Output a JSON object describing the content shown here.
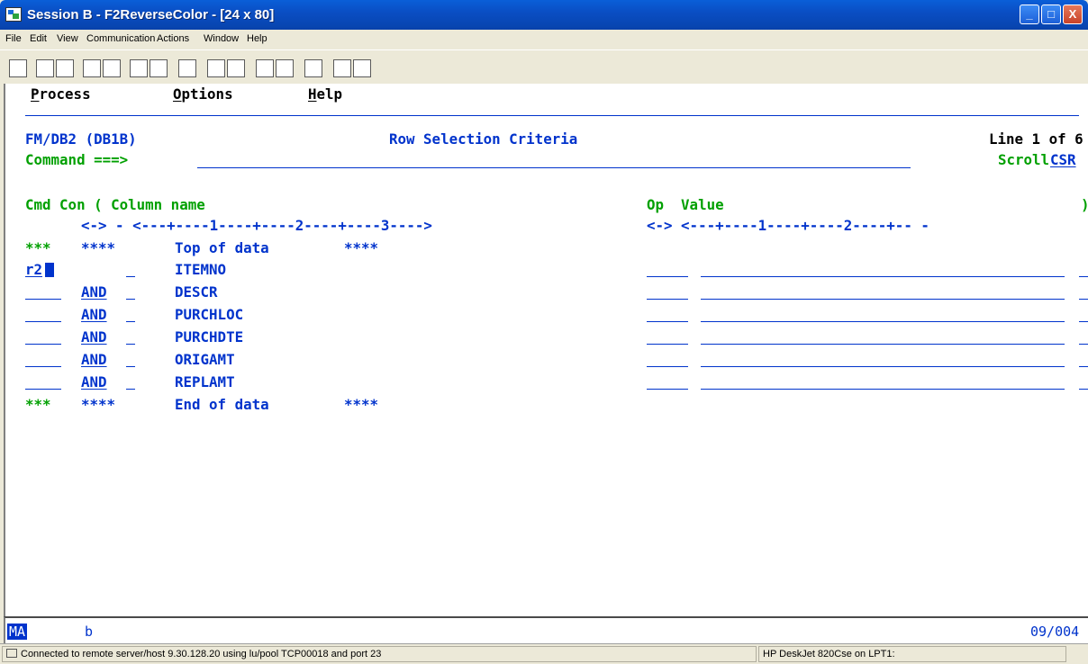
{
  "window": {
    "title": "Session B - F2ReverseColor - [24 x 80]",
    "minimize": "_",
    "maximize": "□",
    "close": "X"
  },
  "menubar": [
    "File",
    "Edit",
    "View",
    "Communication",
    "Actions",
    "Window",
    "Help"
  ],
  "toolbar_icons": [
    "print-screen-icon",
    "copy-icon",
    "paste-icon",
    "send-file-icon",
    "receive-file-icon",
    "display-icon",
    "display-alt-icon",
    "macro-icon",
    "record-macro-icon",
    "stop-macro-icon",
    "play-macro-icon",
    "pause-macro-icon",
    "clipboard-icon",
    "globe-icon",
    "keymap-icon"
  ],
  "terminal": {
    "menu": {
      "process": "Process",
      "options": "Options",
      "help": "Help"
    },
    "header_left": "FM/DB2 (DB1B)",
    "header_title": "Row Selection Criteria",
    "header_right": "Line 1 of 6",
    "command_label": "Command ===>",
    "command_value": "",
    "scroll_label": "Scroll",
    "scroll_value": "CSR",
    "col_header": "Cmd Con ( Column name",
    "op_header": "Op  Value",
    "close_paren": ")",
    "ruler_left": "<-> - <---+----1----+----2----+----3---->",
    "ruler_right": "<-> <---+----1----+----2----+-- -",
    "top_stars1": "***",
    "top_stars2": "****",
    "top_text": "Top of data",
    "top_stars3": "****",
    "rows": [
      {
        "cmd": "r2",
        "con": "",
        "column": "ITEMNO"
      },
      {
        "cmd": "",
        "con": "AND",
        "column": "DESCR"
      },
      {
        "cmd": "",
        "con": "AND",
        "column": "PURCHLOC"
      },
      {
        "cmd": "",
        "con": "AND",
        "column": "PURCHDTE"
      },
      {
        "cmd": "",
        "con": "AND",
        "column": "ORIGAMT"
      },
      {
        "cmd": "",
        "con": "AND",
        "column": "REPLAMT"
      }
    ],
    "end_stars1": "***",
    "end_stars2": "****",
    "end_text": "End of data",
    "end_stars3": "****"
  },
  "oia": {
    "left": "MA",
    "indicator": "b",
    "position": "09/004"
  },
  "statusbar": {
    "connection": "Connected to remote server/host 9.30.128.20 using lu/pool TCP00018 and port 23",
    "printer": "HP DeskJet 820Cse on LPT1:"
  }
}
